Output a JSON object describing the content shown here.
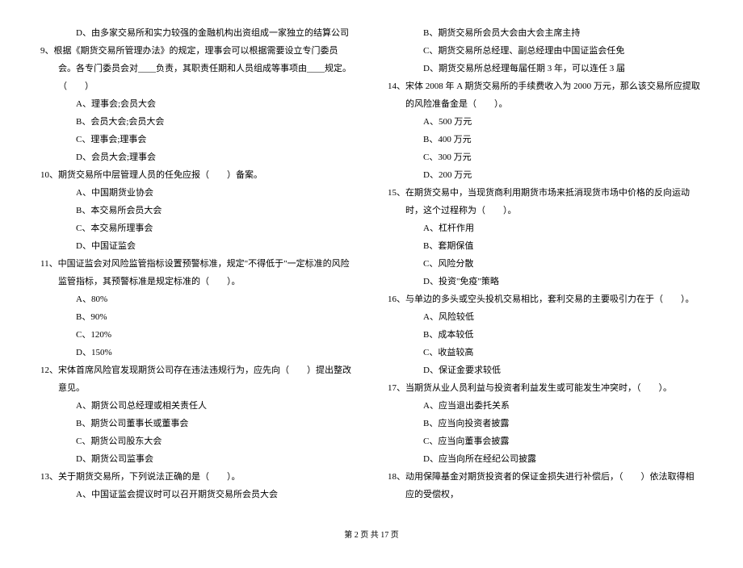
{
  "left": {
    "pre_opt": "D、由多家交易所和实力较强的金融机构出资组成一家独立的结算公司",
    "q9": {
      "text": "9、根据《期货交易所管理办法》的规定，理事会可以根据需要设立专门委员会。各专门委员会对____负责，其职责任期和人员组成等事项由____规定。（　　）",
      "a": "A、理事会;会员大会",
      "b": "B、会员大会;会员大会",
      "c": "C、理事会;理事会",
      "d": "D、会员大会;理事会"
    },
    "q10": {
      "text": "10、期货交易所中层管理人员的任免应报（　　）备案。",
      "a": "A、中国期货业协会",
      "b": "B、本交易所会员大会",
      "c": "C、本交易所理事会",
      "d": "D、中国证监会"
    },
    "q11": {
      "text": "11、中国证监会对风险监管指标设置预警标准，规定\"不得低于\"一定标准的风险监管指标，其预警标准是规定标准的（　　）。",
      "a": "A、80%",
      "b": "B、90%",
      "c": "C、120%",
      "d": "D、150%"
    },
    "q12": {
      "text": "12、宋体首席风险官发现期货公司存在违法违规行为，应先向（　　）提出整改意见。",
      "a": "A、期货公司总经理或相关责任人",
      "b": "B、期货公司董事长或董事会",
      "c": "C、期货公司股东大会",
      "d": "D、期货公司监事会"
    },
    "q13": {
      "text": "13、关于期货交易所，下列说法正确的是（　　）。",
      "a": "A、中国证监会提议时可以召开期货交易所会员大会"
    }
  },
  "right": {
    "q13rest": {
      "b": "B、期货交易所会员大会由大会主席主持",
      "c": "C、期货交易所总经理、副总经理由中国证监会任免",
      "d": "D、期货交易所总经理每届任期 3 年，可以连任 3 届"
    },
    "q14": {
      "text": "14、宋体 2008 年 A 期货交易所的手续费收入为 2000 万元，那么该交易所应提取的风险准备金是（　　）。",
      "a": "A、500 万元",
      "b": "B、400 万元",
      "c": "C、300 万元",
      "d": "D、200 万元"
    },
    "q15": {
      "text": "15、在期货交易中，当现货商利用期货市场来抵消现货市场中价格的反向运动时，这个过程称为（　　）。",
      "a": "A、杠杆作用",
      "b": "B、套期保值",
      "c": "C、风险分散",
      "d": "D、投资\"免疫\"策略"
    },
    "q16": {
      "text": "16、与单边的多头或空头投机交易相比，套利交易的主要吸引力在于（　　）。",
      "a": "A、风险较低",
      "b": "B、成本较低",
      "c": "C、收益较高",
      "d": "D、保证金要求较低"
    },
    "q17": {
      "text": "17、当期货从业人员利益与投资者利益发生或可能发生冲突时，（　　）。",
      "a": "A、应当退出委托关系",
      "b": "B、应当向投资者披露",
      "c": "C、应当向董事会披露",
      "d": "D、应当向所在经纪公司披露"
    },
    "q18": {
      "text": "18、动用保障基金对期货投资者的保证金损失进行补偿后，（　　）依法取得相应的受偿权，"
    }
  },
  "footer": "第 2 页 共 17 页"
}
